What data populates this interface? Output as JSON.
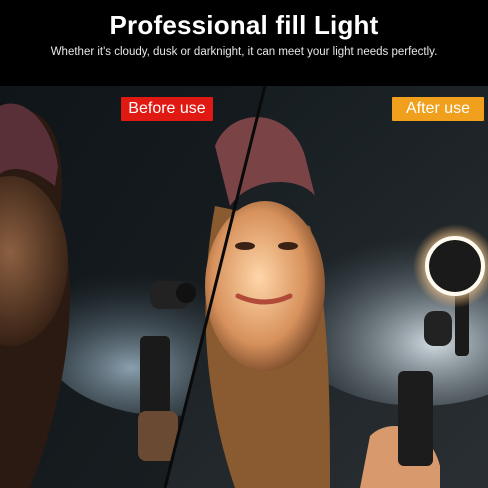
{
  "header": {
    "title": "Professional fill Light",
    "subtitle": "Whether it's cloudy, dusk or darknight, it can meet your light needs perfectly."
  },
  "labels": {
    "before": "Before use",
    "after": "After use"
  },
  "colors": {
    "before_badge": "#e01a13",
    "after_badge": "#f0a01c",
    "background": "#000000"
  }
}
